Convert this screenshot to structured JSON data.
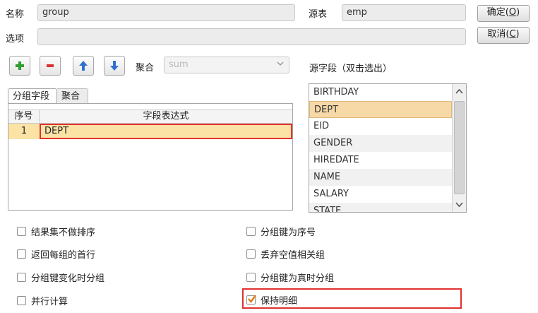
{
  "form": {
    "name_label": "名称",
    "name_value": "group",
    "source_label": "源表",
    "source_value": "emp",
    "options_label": "选项",
    "options_value": ""
  },
  "buttons": {
    "ok_label": "确定(",
    "ok_key": "O",
    "ok_close": ")",
    "cancel_label": "取消(",
    "cancel_key": "C",
    "cancel_close": ")"
  },
  "toolbar": {
    "aggregate_label": "聚合",
    "aggregate_value": "sum"
  },
  "tabs": [
    {
      "label": "分组字段",
      "active": true
    },
    {
      "label": "聚合",
      "active": false
    }
  ],
  "grid": {
    "headers": [
      "序号",
      "字段表达式"
    ],
    "rows": [
      {
        "index": "1",
        "expr": "DEPT"
      }
    ]
  },
  "source_fields": {
    "label": "源字段（双击选出）",
    "items": [
      "BIRTHDAY",
      "DEPT",
      "EID",
      "GENDER",
      "HIREDATE",
      "NAME",
      "SALARY",
      "STATE"
    ],
    "selected": "DEPT"
  },
  "options": [
    {
      "label": "结果集不做排序",
      "checked": false
    },
    {
      "label": "分组键为序号",
      "checked": false
    },
    {
      "label": "返回每组的首行",
      "checked": false
    },
    {
      "label": "丢弃空值相关组",
      "checked": false
    },
    {
      "label": "分组键变化时分组",
      "checked": false
    },
    {
      "label": "分组键为真时分组",
      "checked": false
    },
    {
      "label": "并行计算",
      "checked": false
    },
    {
      "label": "保持明细",
      "checked": true
    }
  ],
  "colors": {
    "highlight_red": "#e0322e",
    "row_selected": "#f7d9a7",
    "plus_green": "#2f9e2f",
    "minus_red": "#d9332e",
    "arrow_blue": "#2f6fce"
  }
}
